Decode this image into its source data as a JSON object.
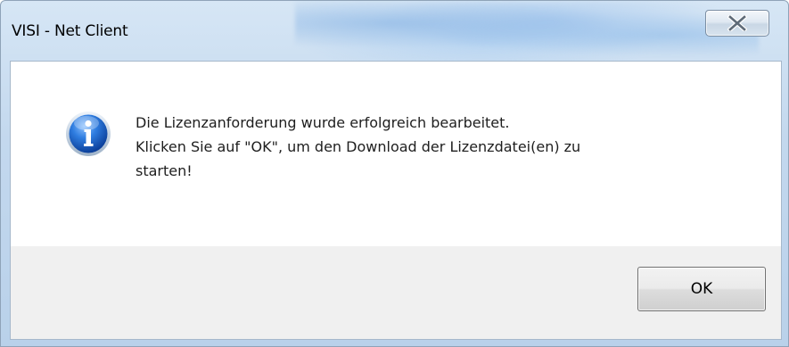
{
  "window": {
    "title": "VISI - Net Client"
  },
  "message": {
    "lines": [
      "Die Lizenzanforderung wurde erfolgreich bearbeitet.",
      "Klicken Sie auf \"OK\", um den Download der Lizenzdatei(en) zu",
      "starten!"
    ]
  },
  "buttons": {
    "ok_label": "OK"
  },
  "icons": {
    "close": "close-icon",
    "info": "information-icon"
  },
  "colors": {
    "frame": "#c3d8ee",
    "button_panel": "#f0f0f0",
    "info_blue": "#1f64c8"
  }
}
